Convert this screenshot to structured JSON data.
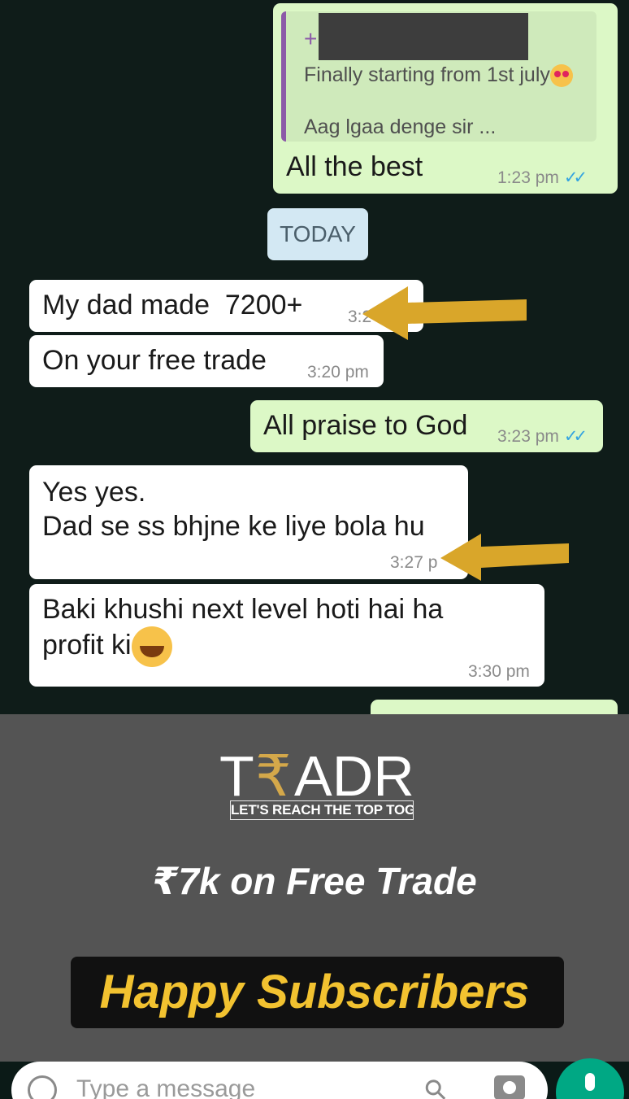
{
  "chat": {
    "quote": {
      "line1": "Finally starting from 1st july",
      "line2": "Aag lgaa denge sir ..."
    },
    "messages": [
      {
        "text": "All the best",
        "time": "1:23 pm"
      },
      {
        "text": "My dad made  7200+",
        "time": "3:2"
      },
      {
        "text": "On your free trade",
        "time": "3:20 pm"
      },
      {
        "text": "All praise to God",
        "time": "3:23 pm"
      },
      {
        "text": "Yes yes.\nDad se ss bhjne ke liye bola hu",
        "time": "3:27 p"
      },
      {
        "text": "Baki khushi next level hoti hai ha\nprofit ki",
        "time": "3:30 pm"
      }
    ],
    "date_separator": "TODAY"
  },
  "banner": {
    "logo": "T₹ADR",
    "tagline": "LET'S REACH THE TOP TOGETHER",
    "headline": "₹7k on Free Trade",
    "happy": "Happy Subscribers"
  },
  "input": {
    "placeholder": "Type a message"
  },
  "icons": {
    "smiley": "emoji-icon",
    "attach": "paperclip-icon",
    "camera": "camera-icon",
    "mic": "microphone-icon",
    "read": "double-check-icon"
  },
  "colors": {
    "incoming": "#ffffff",
    "outgoing": "#dcf8c6",
    "accent": "#00a884",
    "gold": "#f2c230",
    "arrow": "#d9a62a"
  }
}
